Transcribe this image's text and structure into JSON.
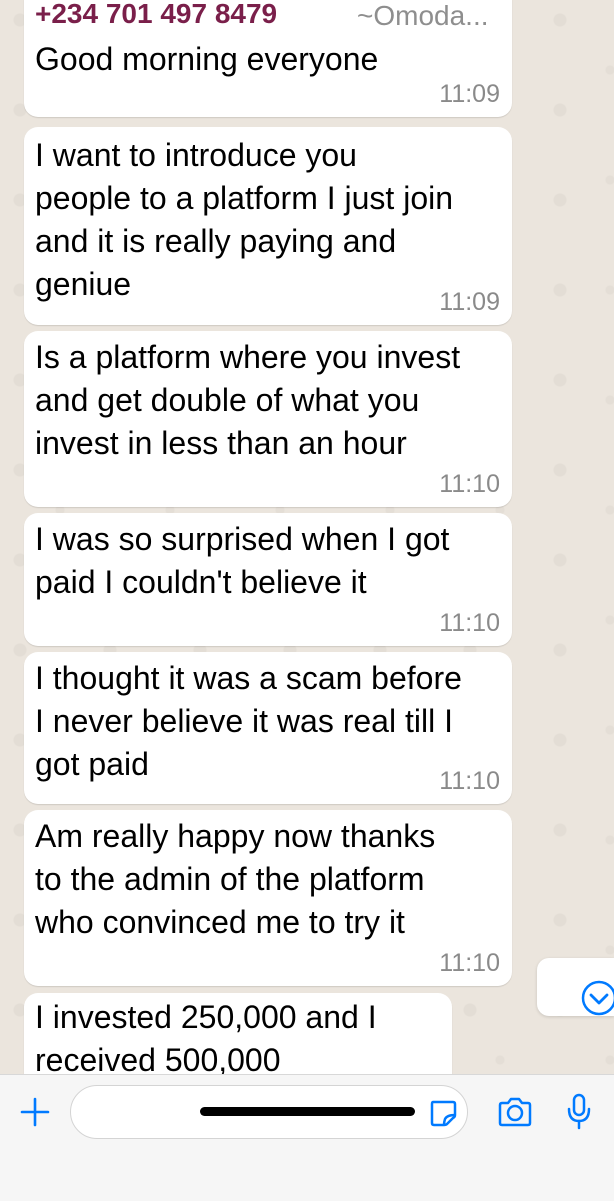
{
  "messages": [
    {
      "sender_phone": "+234 701 497 8479",
      "sender_name": "~Omoda...",
      "text": "Good morning everyone",
      "time": "11:09"
    },
    {
      "text": "I want to introduce you\npeople to a platform I just join\nand it is really paying and\ngeniue",
      "time": "11:09"
    },
    {
      "text": "Is a platform where you invest\nand get double of what you\ninvest in less than an hour",
      "time": "11:10"
    },
    {
      "text": "I was so surprised when I  got\npaid I couldn't believe it",
      "time": "11:10"
    },
    {
      "text": "I thought it was a scam before\nI never believe it was real till I\ngot paid",
      "time": "11:10"
    },
    {
      "text": "Am really  happy now thanks\nto the admin of the platform\nwho convinced me to try it",
      "time": "11:10"
    },
    {
      "text": "I invested 250,000 and I\nreceived 500,000",
      "time": ""
    }
  ],
  "composer": {
    "input_value": ""
  },
  "icons": {
    "attach": "plus-icon",
    "sticker": "sticker-icon",
    "camera": "camera-icon",
    "mic": "microphone-icon",
    "scroll": "chevron-down-circle-icon"
  },
  "colors": {
    "accent": "#007aff",
    "sender": "#7a1f4a",
    "background": "#ebe5dd"
  }
}
